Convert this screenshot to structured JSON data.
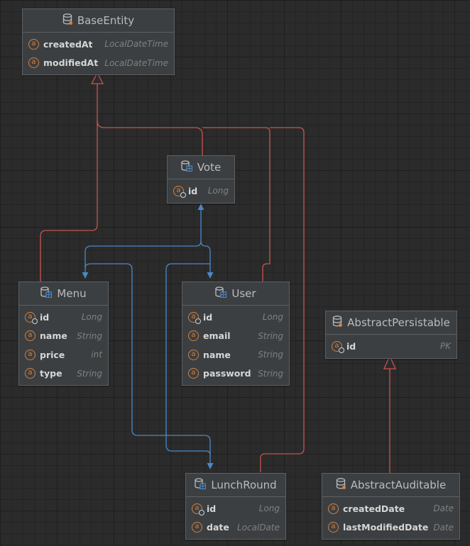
{
  "entities": {
    "base_entity": {
      "title": "BaseEntity",
      "fields": [
        {
          "name": "createdAt",
          "type": "LocalDateTime"
        },
        {
          "name": "modifiedAt",
          "type": "LocalDateTime"
        }
      ]
    },
    "vote": {
      "title": "Vote",
      "fields": [
        {
          "name": "id",
          "type": "Long"
        }
      ]
    },
    "menu": {
      "title": "Menu",
      "fields": [
        {
          "name": "id",
          "type": "Long"
        },
        {
          "name": "name",
          "type": "String"
        },
        {
          "name": "price",
          "type": "int"
        },
        {
          "name": "type",
          "type": "String"
        }
      ]
    },
    "user": {
      "title": "User",
      "fields": [
        {
          "name": "id",
          "type": "Long"
        },
        {
          "name": "email",
          "type": "String"
        },
        {
          "name": "name",
          "type": "String"
        },
        {
          "name": "password",
          "type": "String"
        }
      ]
    },
    "abstract_persistable": {
      "title": "AbstractPersistable",
      "fields": [
        {
          "name": "id",
          "type": "PK"
        }
      ]
    },
    "lunch_round": {
      "title": "LunchRound",
      "fields": [
        {
          "name": "id",
          "type": "Long"
        },
        {
          "name": "date",
          "type": "LocalDate"
        }
      ]
    },
    "abstract_auditable": {
      "title": "AbstractAuditable",
      "fields": [
        {
          "name": "createdDate",
          "type": "Date"
        },
        {
          "name": "lastModifiedDate",
          "type": "Date"
        }
      ]
    }
  },
  "colors": {
    "inheritance_edge": "#c75450",
    "association_edge": "#4a88c7",
    "field_icon": "#d4803f"
  }
}
